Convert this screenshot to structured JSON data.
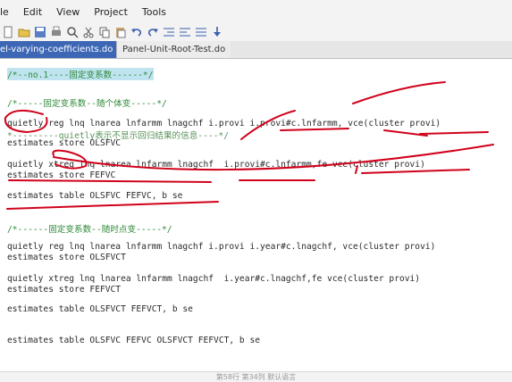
{
  "menubar": {
    "items": [
      {
        "label": "le"
      },
      {
        "label": "Edit"
      },
      {
        "label": "View"
      },
      {
        "label": "Project"
      },
      {
        "label": "Tools"
      }
    ]
  },
  "toolbar": {
    "icons": [
      "new-file-icon",
      "open-icon",
      "save-icon",
      "print-icon",
      "find-icon",
      "cut-icon",
      "copy-icon",
      "paste-icon",
      "undo-icon",
      "redo-icon",
      "indent-icon",
      "outdent-icon",
      "execute-icon",
      "do-icon"
    ]
  },
  "tabs": [
    {
      "label": "el-varying-coefficients.do",
      "active": true
    },
    {
      "label": "Panel-Unit-Root-Test.do",
      "active": false
    }
  ],
  "code": {
    "l1": "/*--no.1----固定变系数------*/",
    "l2": "/*-----固定变系数--随个体变-----*/",
    "l3": "quietly reg lnq lnarea lnfarmm lnagchf i.provi i.provi#c.lnfarmm, vce(cluster provi)",
    "l4": "*---------quietly表示不显示回归结果的信息----*/",
    "l5": "estimates store OLSFVC",
    "l6": "quietly xtreg lnq lnarea lnfarmm lnagchf  i.provi#c.lnfarmm,fe vce(cluster provi)",
    "l7": "estimates store FEFVC",
    "l8": "estimates table OLSFVC FEFVC, b se",
    "l9": "/*------固定变系数--随时点变-----*/",
    "l10": "quietly reg lnq lnarea lnfarmm lnagchf i.provi i.year#c.lnagchf, vce(cluster provi)",
    "l11": "estimates store OLSFVCT",
    "l12": "quietly xtreg lnq lnarea lnfarmm lnagchf  i.year#c.lnagchf,fe vce(cluster provi)",
    "l13": "estimates store FEFVCT",
    "l14": "estimates table OLSFVCT FEFVCT, b se",
    "l15": "estimates table OLSFVC FEFVC OLSFVCT FEFVCT, b se"
  },
  "status": {
    "text": "第58行 第34列    默认语言"
  },
  "colors": {
    "accent_tab": "#3d67b5",
    "comment": "#2f8a38",
    "highlight": "#bfe4f0",
    "ink": "#d0021b"
  }
}
